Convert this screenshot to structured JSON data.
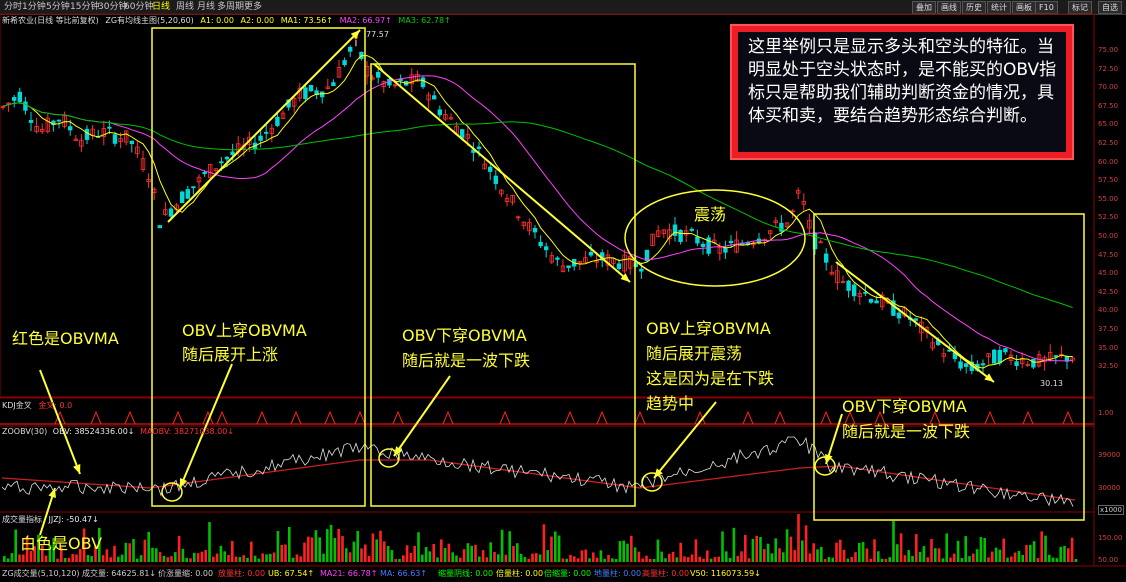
{
  "toolbar": {
    "timeframes": [
      "分时",
      "1分钟",
      "5分钟",
      "15分钟",
      "30分钟",
      "60分钟",
      "日线",
      "周线",
      "月线",
      "多周期",
      "更多"
    ],
    "active_index": 6,
    "buttons": [
      "叠加",
      "画线",
      "历史",
      "统计",
      "画板",
      "F10",
      "标记",
      "自选"
    ]
  },
  "price_info": {
    "stock": "新希农业(日线 等比前复权)",
    "indicator": "ZG有均线主图(5,20,60)",
    "a1": "A1: 0.00",
    "a2": "A2: 0.00",
    "ma1": "MA1: 73.56↑",
    "ma2": "MA2: 66.97↑",
    "ma3": "MA3: 62.78↑"
  },
  "price_axis": {
    "labels": [
      "75.00",
      "72.50",
      "70.00",
      "67.50",
      "65.00",
      "62.50",
      "60.00",
      "57.50",
      "55.00",
      "52.50",
      "50.00",
      "47.50",
      "45.00",
      "42.50",
      "40.00",
      "37.50",
      "35.00",
      "32.50"
    ],
    "high_label": "77.57",
    "low_label": "30.13"
  },
  "kdj_info": {
    "title": "KDJ金叉",
    "value": "金叉: 0.0"
  },
  "kdj_axis": [
    "1.00"
  ],
  "obv_info": {
    "title": "ZOOBV(30)",
    "obv": "OBV: 38524336.00↓",
    "obvma": "MAOBV: 38271038.00↓"
  },
  "obv_axis": [
    "39000",
    "30000"
  ],
  "obv_unit": "x1000",
  "vol_info": {
    "title": "成交量指标",
    "value": "JJZJ: -50.47↓"
  },
  "vol_axis": [
    "150.00",
    "50.00"
  ],
  "footer": [
    {
      "text": "ZG成交量(5,10,120)",
      "color": "#cccccc"
    },
    {
      "text": "成交量: 64625.81↓",
      "color": "#cccccc"
    },
    {
      "text": "价涨量缩: 0.00",
      "color": "#cccccc"
    },
    {
      "text": "放量柱: 0.00",
      "color": "#ff3030"
    },
    {
      "text": "UB: 67.54↑",
      "color": "#ffff00"
    },
    {
      "text": "MA21: 66.78↑",
      "color": "#ff40ff"
    },
    {
      "text": "MA: 66.63↑",
      "color": "#4080ff"
    },
    {
      "text": "缩量阴线: 0.00",
      "color": "#00ff00"
    },
    {
      "text": "倍量柱: 0.00",
      "color": "#ffff00"
    },
    {
      "text": "倍缩量: 0.00",
      "color": "#00ff00"
    },
    {
      "text": "地量柱: 0.00",
      "color": "#4080ff"
    },
    {
      "text": "高量柱: 0.00",
      "color": "#ff3030"
    },
    {
      "text": "V50: 116073.59↓",
      "color": "#ffff00"
    }
  ],
  "note": "这里举例只是显示多头和空头的特征。当明显处于空头状态时，是不能买的OBV指标只是帮助我们辅助判断资金的情况，具体买和卖，要结合趋势形态综合判断。",
  "annotations": {
    "red_is": "红色是OBVMA",
    "white_is": "白色是OBV",
    "box1": [
      "OBV上穿OBVMA",
      "随后展开上涨"
    ],
    "box2": [
      "OBV下穿OBVMA",
      "随后就是一波下跌"
    ],
    "box3": [
      "OBV上穿OBVMA",
      "随后展开震荡",
      "这是因为是在下跌",
      "趋势中"
    ],
    "box4": [
      "OBV下穿OBVMA",
      "随后就是一波下跌"
    ],
    "oscillation": "震荡"
  },
  "colors": {
    "up": "#ff3030",
    "down": "#00d8d8",
    "ma1": "#ffff00",
    "ma2": "#ff40ff",
    "ma3": "#00c000",
    "annotation": "#ffff33",
    "obv": "#e0e0e0",
    "obvma": "#cc2020"
  }
}
